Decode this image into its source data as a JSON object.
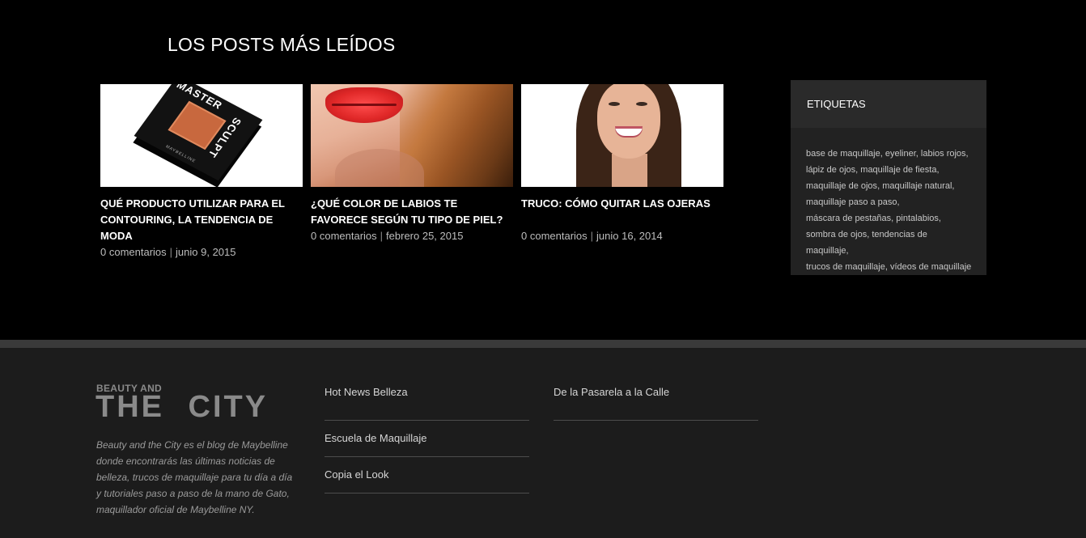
{
  "section": {
    "title": "LOS POSTS MÁS LEÍDOS"
  },
  "posts": [
    {
      "title": "QUÉ PRODUCTO UTILIZAR PARA EL CONTOURING, LA TENDENCIA DE MODA",
      "comments": "0 comentarios",
      "date": "junio 9, 2015",
      "image_text": [
        "MASTER",
        "SCULPT",
        "MAYBELLINE"
      ]
    },
    {
      "title": "¿QUÉ COLOR DE LABIOS TE FAVORECE SEGÚN TU TIPO DE PIEL?",
      "comments": "0 comentarios",
      "date": "febrero 25, 2015"
    },
    {
      "title": "TRUCO: CÓMO QUITAR LAS OJERAS",
      "comments": "0 comentarios",
      "date": "junio 16, 2014"
    }
  ],
  "sidebar": {
    "title": "ETIQUETAS",
    "tags": [
      "base de maquillaje",
      "eyeliner",
      "labios rojos",
      "lápiz de ojos",
      "maquillaje de fiesta",
      "maquillaje de ojos",
      "maquillaje natural",
      "maquillaje paso a paso",
      "máscara de pestañas",
      "pintalabios",
      "sombra de ojos",
      "tendencias de maquillaje",
      "trucos de maquillaje",
      "vídeos de maquillaje"
    ]
  },
  "footer": {
    "logo_small": "BEAUTY AND",
    "logo_big": "THE CITY",
    "about": "Beauty and the City es el blog de Maybelline donde encontrarás las últimas noticias de belleza, trucos de maquillaje para tu día a día y tutoriales paso a paso de la mano de Gato, maquillador oficial de Maybelline NY.",
    "menu_1": [
      "Hot News Belleza",
      "Escuela de Maquillaje",
      "Copia el Look"
    ],
    "menu_2": [
      "De la Pasarela a la Calle"
    ]
  }
}
